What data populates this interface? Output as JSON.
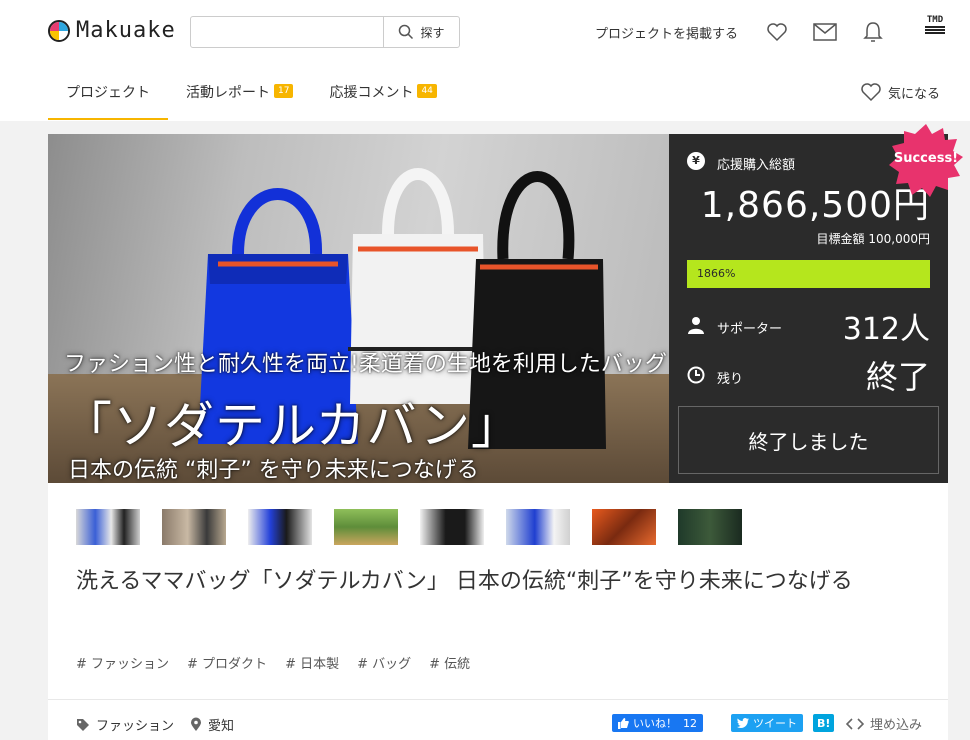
{
  "header": {
    "logo_text": "Makuake",
    "search_placeholder": "",
    "search_button": "探す",
    "post_project": "プロジェクトを掲載する",
    "account_logo": "TMD"
  },
  "tabs": [
    {
      "label": "プロジェクト",
      "badge": ""
    },
    {
      "label": "活動レポート",
      "badge": "17"
    },
    {
      "label": "応援コメント",
      "badge": "44"
    }
  ],
  "favorite_label": "気になる",
  "hero": {
    "line1": "ファション性と耐久性を両立!柔道着の生地を利用したバッグ",
    "line2": "「ソダテルカバン」",
    "line3": "日本の伝統 “刺子” を守り未来につなげる"
  },
  "panel": {
    "total_label": "応援購入総額",
    "yen_symbol": "¥",
    "amount": "1,866,500円",
    "goal": "目標金額 100,000円",
    "progress_text": "1866%",
    "progress_fraction": 1.0,
    "supporters_label": "サポーター",
    "supporters_value": "312人",
    "remaining_label": "残り",
    "remaining_value": "終了",
    "ended_button": "終了しました",
    "success_badge": "Success!"
  },
  "thumbnails": [
    "thumb-1",
    "thumb-2",
    "thumb-3",
    "thumb-4",
    "thumb-5",
    "thumb-6",
    "thumb-7",
    "thumb-8"
  ],
  "project_title": "洗えるママバッグ「ソダテルカバン」 日本の伝統“刺子”を守り未来につなげる",
  "tags": [
    "# ファッション",
    "# プロダクト",
    "# 日本製",
    "# バッグ",
    "# 伝統"
  ],
  "meta": {
    "category": "ファッション",
    "location": "愛知"
  },
  "share": {
    "like_label": "いいね！",
    "like_count": "12",
    "tweet_label": "ツイート",
    "hatena_label": "B!",
    "embed_label": "埋め込み"
  },
  "colors": {
    "accent": "#f7b500",
    "panel_bg": "#2b2b2b",
    "progress": "#b5e61d",
    "success": "#e8336d",
    "facebook": "#1877f2",
    "twitter": "#1da1f2",
    "hatena": "#00a4de"
  }
}
